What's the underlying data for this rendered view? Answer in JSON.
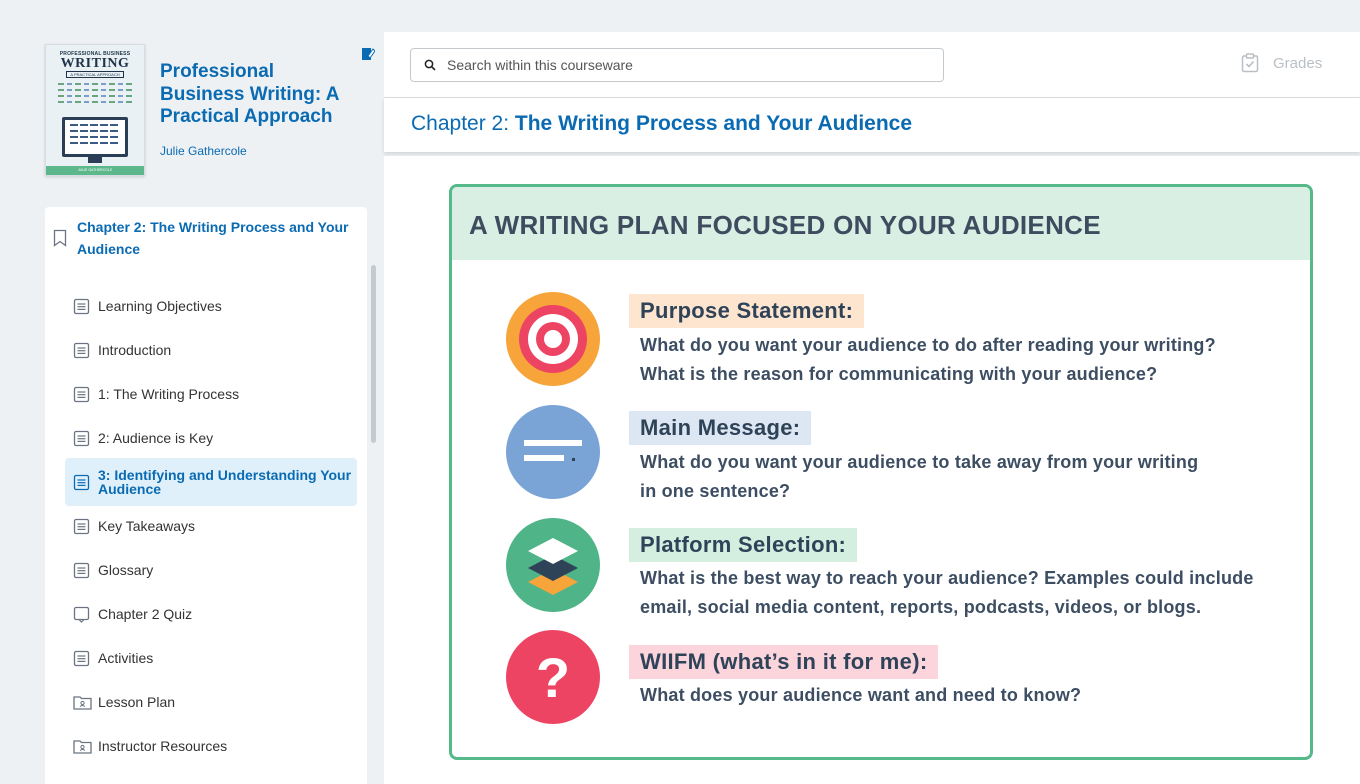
{
  "book": {
    "title": "Professional Business Writing: A Practical Approach",
    "author": "Julie Gathercole",
    "cover": {
      "top_line": "PROFESSIONAL BUSINESS",
      "title": "WRITING",
      "subtitle": "A PRACTICAL APPROACH",
      "author": "JULIE GATHERCOLE"
    }
  },
  "toc": {
    "chapter_label": "Chapter 2: The Writing Process and Your Audience",
    "items": [
      {
        "label": "Learning Objectives",
        "icon": "page-icon"
      },
      {
        "label": "Introduction",
        "icon": "page-icon"
      },
      {
        "label": "1: The Writing Process",
        "icon": "page-icon"
      },
      {
        "label": "2: Audience is Key",
        "icon": "page-icon"
      },
      {
        "label": "3: Identifying and Understanding Your Audience",
        "icon": "page-icon",
        "active": true
      },
      {
        "label": "Key Takeaways",
        "icon": "page-icon"
      },
      {
        "label": "Glossary",
        "icon": "page-icon"
      },
      {
        "label": "Chapter 2 Quiz",
        "icon": "quiz-icon"
      },
      {
        "label": "Activities",
        "icon": "page-icon"
      },
      {
        "label": "Lesson Plan",
        "icon": "folder-icon"
      },
      {
        "label": "Instructor Resources",
        "icon": "folder-icon"
      }
    ]
  },
  "search": {
    "placeholder": "Search within this courseware"
  },
  "grades": {
    "label": "Grades"
  },
  "chapter_header": {
    "prefix": "Chapter 2: ",
    "title": "The Writing Process and Your Audience"
  },
  "plan": {
    "title": "A WRITING PLAN FOCUSED ON YOUR AUDIENCE",
    "sections": [
      {
        "heading": "Purpose Statement:",
        "lines": [
          "What do you want your audience to do after reading your writing?",
          "What is the reason for communicating with your audience?"
        ],
        "icon": "target-icon",
        "highlight": "#fde5cf",
        "circle_color": "#f7a43a"
      },
      {
        "heading": "Main Message:",
        "lines": [
          "What do you want your audience to take away from your writing",
          "in one sentence?"
        ],
        "icon": "message-icon",
        "highlight": "#dde7f4",
        "circle_color": "#7aa3d6"
      },
      {
        "heading": "Platform Selection:",
        "lines": [
          "What is the best way to reach your audience? Examples could include",
          "email, social media content, reports, podcasts, videos, or blogs."
        ],
        "icon": "layers-icon",
        "highlight": "#d4eee0",
        "circle_color": "#4fb488"
      },
      {
        "heading": "WIIFM (what’s in it for me):",
        "lines": [
          "What does your audience want and need to know?"
        ],
        "icon": "question-icon",
        "highlight": "#fbd4dc",
        "circle_color": "#ee4463"
      }
    ]
  }
}
